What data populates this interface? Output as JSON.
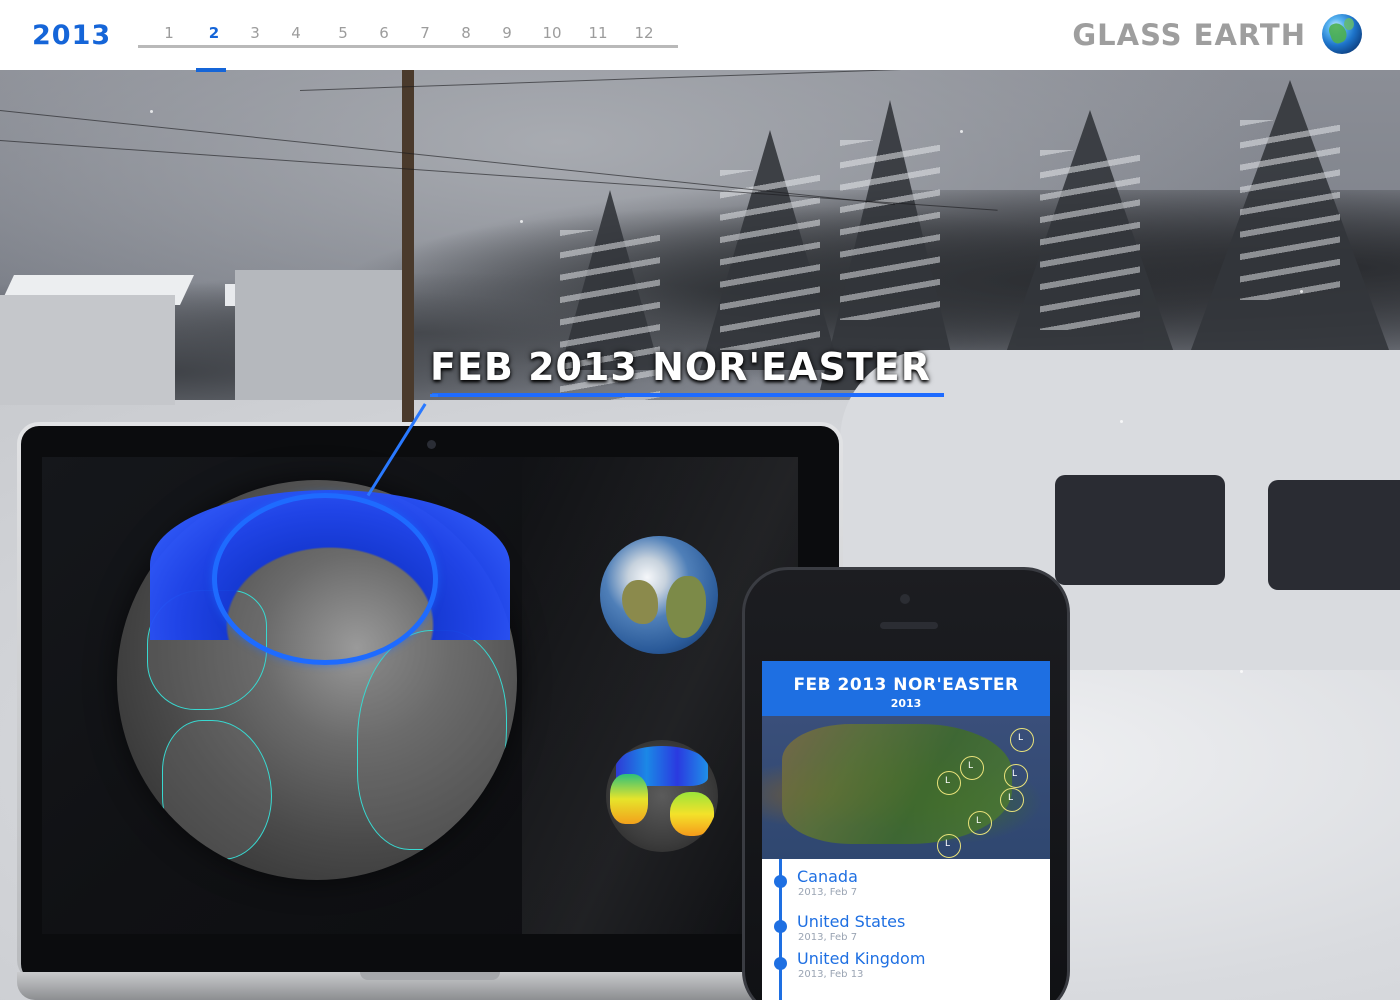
{
  "header": {
    "year": "2013",
    "months": [
      "1",
      "2",
      "3",
      "4",
      "5",
      "6",
      "7",
      "8",
      "9",
      "10",
      "11",
      "12"
    ],
    "active_month": "2",
    "brand": "GLASS EARTH",
    "brand_icon": "globe-icon"
  },
  "event": {
    "title": "FEB 2013 NOR'EASTER"
  },
  "colors": {
    "accent": "#1e6fe2",
    "highlight": "#1e6bff",
    "coastline": "#38d8d0"
  },
  "phone": {
    "title": "FEB 2013 NOR'EASTER",
    "subtitle": "2013",
    "timeline": [
      {
        "name": "Canada",
        "date": "2013, Feb 7"
      },
      {
        "name": "United States",
        "date": "2013, Feb 7"
      },
      {
        "name": "United Kingdom",
        "date": "2013, Feb 13"
      }
    ]
  }
}
